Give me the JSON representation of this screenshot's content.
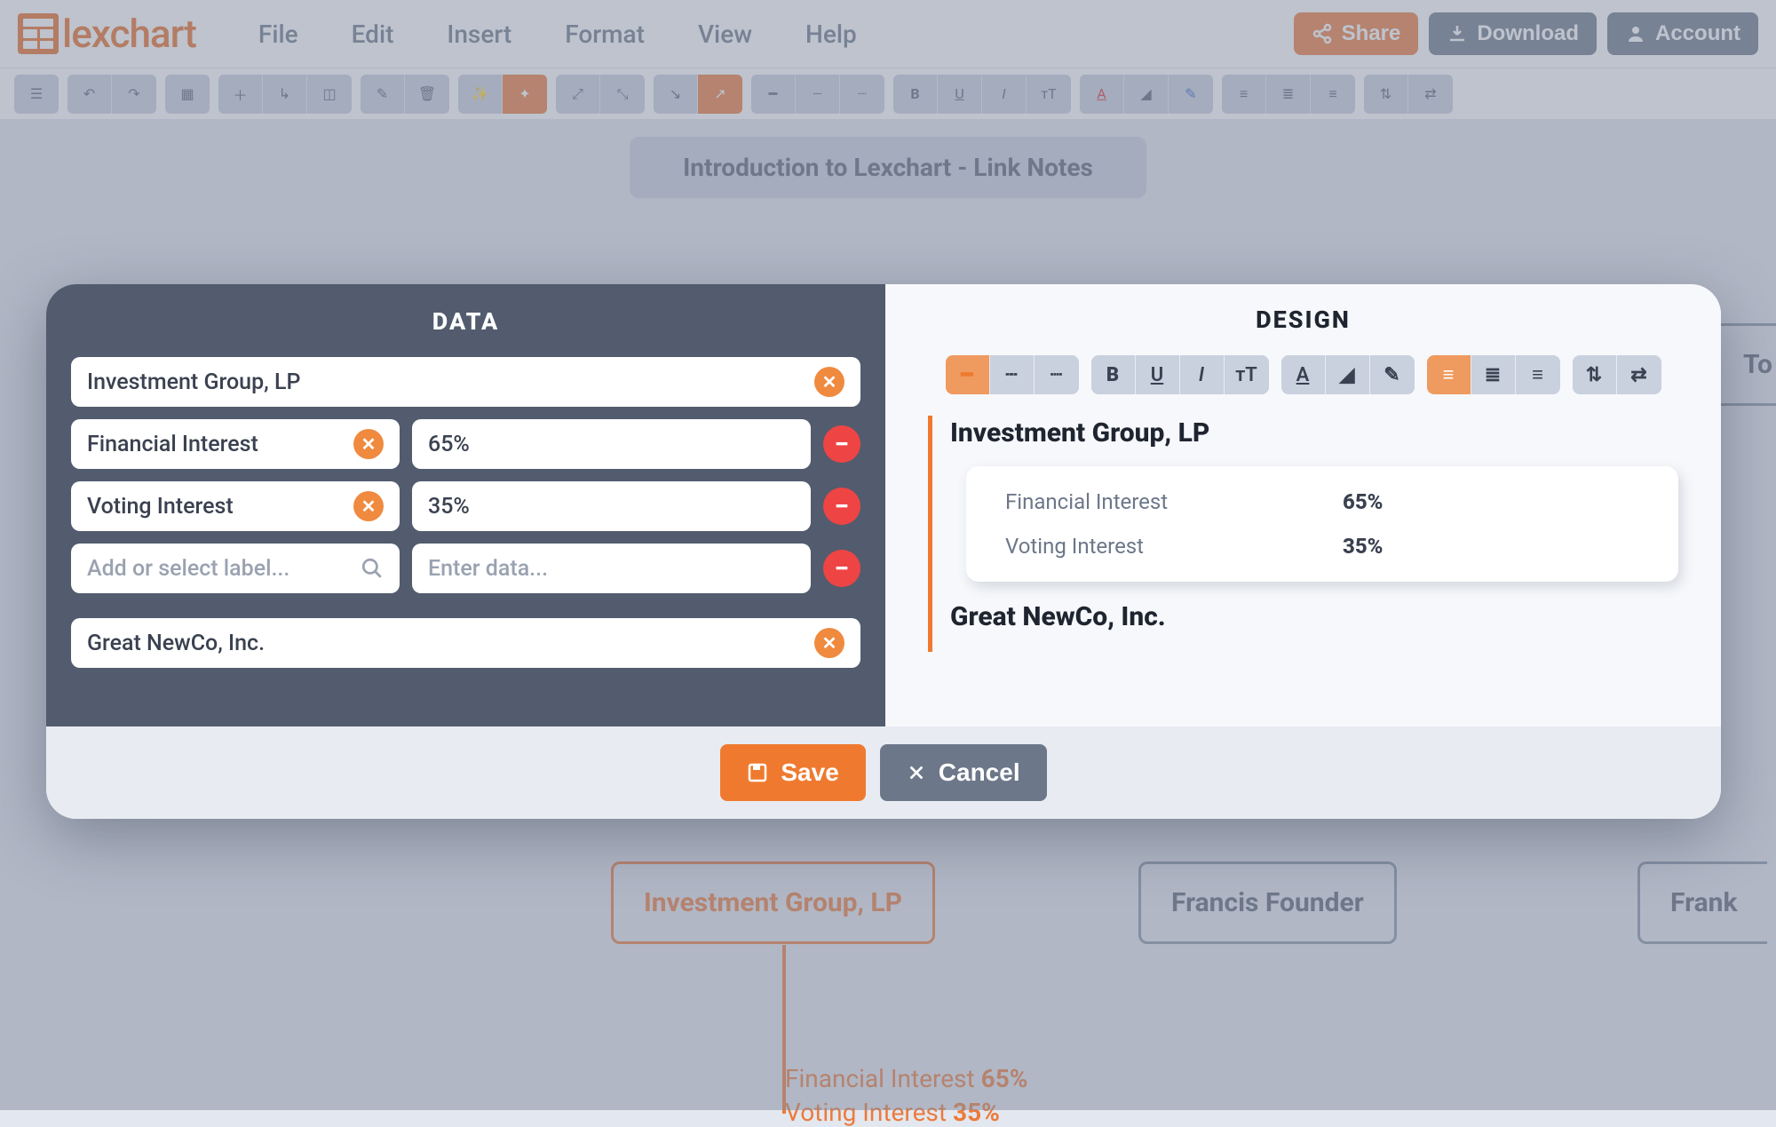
{
  "brand": "lexchart",
  "menu": {
    "file": "File",
    "edit": "Edit",
    "insert": "Insert",
    "format": "Format",
    "view": "View",
    "help": "Help"
  },
  "actions": {
    "share": "Share",
    "download": "Download",
    "account": "Account"
  },
  "chart_title": "Introduction to Lexchart - Link Notes",
  "nodes": {
    "invest": "Investment Group, LP",
    "francis": "Francis Founder",
    "frank": "Frank",
    "top_right": "To"
  },
  "link_labels": {
    "fin": "Financial Interest",
    "fin_v": "65%",
    "vot": "Voting Interest",
    "vot_v": "35%"
  },
  "modal": {
    "data_title": "DATA",
    "design_title": "DESIGN",
    "source": "Investment Group, LP",
    "rows": [
      {
        "label": "Financial Interest",
        "value": "65%"
      },
      {
        "label": "Voting Interest",
        "value": "35%"
      }
    ],
    "label_placeholder": "Add or select label...",
    "value_placeholder": "Enter data...",
    "target": "Great NewCo, Inc.",
    "preview_source": "Investment Group, LP",
    "preview_rows": [
      {
        "k": "Financial Interest",
        "v": "65%"
      },
      {
        "k": "Voting Interest",
        "v": "35%"
      }
    ],
    "preview_target": "Great NewCo, Inc.",
    "save": "Save",
    "cancel": "Cancel"
  }
}
